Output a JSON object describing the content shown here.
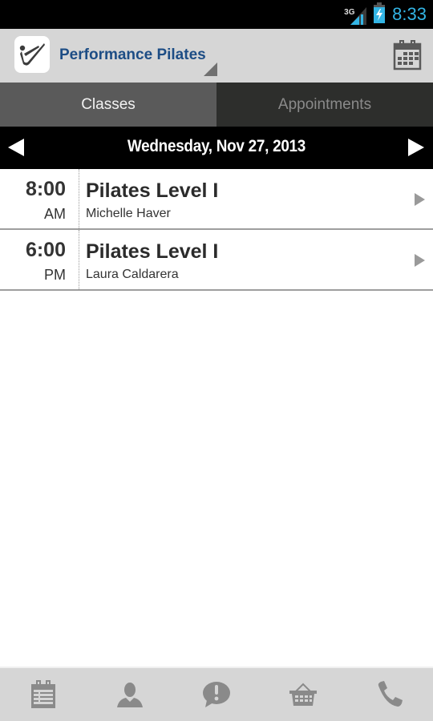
{
  "status_bar": {
    "network_type": "3G",
    "time": "8:33",
    "icons": [
      "signal-icon",
      "battery-charging-icon"
    ]
  },
  "action_bar": {
    "app_title": "Performance Pilates",
    "logo_icon": "pilates-figure-logo",
    "right_icon": "calendar-icon"
  },
  "tabs": [
    {
      "label": "Classes",
      "active": true
    },
    {
      "label": "Appointments",
      "active": false
    }
  ],
  "date_nav": {
    "date": "Wednesday, Nov 27, 2013",
    "prev_icon": "arrow-left-icon",
    "next_icon": "arrow-right-icon"
  },
  "classes": [
    {
      "time": "8:00",
      "period": "AM",
      "name": "Pilates Level I",
      "instructor": "Michelle Haver"
    },
    {
      "time": "6:00",
      "period": "PM",
      "name": "Pilates Level I",
      "instructor": "Laura Caldarera"
    }
  ],
  "bottom_nav": [
    {
      "icon": "schedule-icon"
    },
    {
      "icon": "profile-icon"
    },
    {
      "icon": "alert-message-icon"
    },
    {
      "icon": "basket-icon"
    },
    {
      "icon": "phone-icon"
    }
  ],
  "colors": {
    "title_blue": "#1d4d85",
    "clock_blue": "#33b5e5",
    "active_tab": "#5a5a5a",
    "inactive_tab": "#2d2e2c",
    "bar_gray": "#d6d6d6"
  }
}
